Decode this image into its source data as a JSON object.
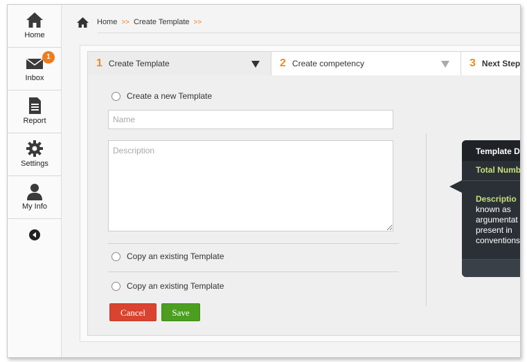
{
  "sidebar": {
    "items": [
      {
        "label": "Home",
        "icon": "home-icon"
      },
      {
        "label": "Inbox",
        "icon": "envelope-icon",
        "badge": "1"
      },
      {
        "label": "Report",
        "icon": "document-icon"
      },
      {
        "label": "Settings",
        "icon": "gear-icon"
      },
      {
        "label": "My Info",
        "icon": "user-icon"
      }
    ],
    "back_icon": "back-arrow-icon"
  },
  "breadcrumb": {
    "home": "Home",
    "current": "Create Template",
    "separator": ">>"
  },
  "steps": [
    {
      "num": "1",
      "label": "Create Template",
      "active": true
    },
    {
      "num": "2",
      "label": "Create competency",
      "active": false
    },
    {
      "num": "3",
      "label": "Next Step",
      "active": false
    }
  ],
  "form": {
    "create_new_label": "Create a new Template",
    "name_placeholder": "Name",
    "description_placeholder": "Description",
    "copy_existing_label_1": "Copy an existing Template",
    "copy_existing_label_2": "Copy an existing Template",
    "cancel_label": "Cancel",
    "save_label": "Save"
  },
  "tooltip": {
    "title": "Template D",
    "total_label": "Total Numb",
    "description_label": "Descriptio",
    "description_lines": [
      "known  as",
      "argumentat",
      "present in",
      "conventions"
    ]
  },
  "colors": {
    "accent": "#f07b1d",
    "cancel": "#d9432f",
    "save": "#4b9e1f",
    "tooltip_bg": "#2b3036",
    "tooltip_highlight": "#c5e07a"
  }
}
